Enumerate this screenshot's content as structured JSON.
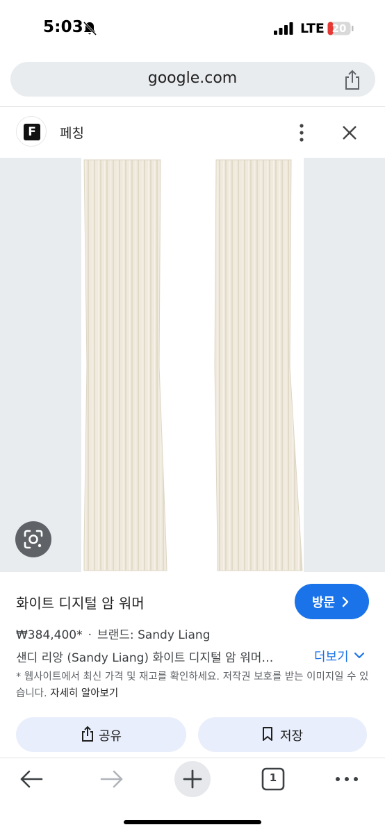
{
  "status_bar": {
    "time": "5:03",
    "network": "LTE",
    "battery_level": "20",
    "battery_color": "#e53935",
    "icons": [
      "bell-slash-icon",
      "signal-icon",
      "battery-icon"
    ]
  },
  "browser": {
    "url": "google.com",
    "share_icon": "share-icon"
  },
  "source": {
    "logo_letter": "F",
    "site_name": "페칭"
  },
  "image": {
    "alt": "white ribbed knit arm warmers",
    "lens_icon": "google-lens-icon"
  },
  "product": {
    "title": "화이트 디지털 암 워머",
    "price": "₩384,400*",
    "separator": "·",
    "brand": "브랜드: Sandy Liang",
    "description": "샌디 리앙 (Sandy Liang) 화이트 디지털 암 워머…",
    "more_label": "더보기",
    "visit_label": "방문",
    "notice_text": "* 웹사이트에서 최신 가격 및 재고를 확인하세요. 저작권 보호를 받는 이미지일 수 있습니다.",
    "notice_link": "자세히 알아보기"
  },
  "actions": {
    "share_label": "공유",
    "save_label": "저장"
  },
  "toolbar": {
    "tab_count": "1"
  },
  "colors": {
    "accent": "#1a73e8",
    "pill_bg": "#e8eefb",
    "image_bg": "#e9ecef"
  }
}
